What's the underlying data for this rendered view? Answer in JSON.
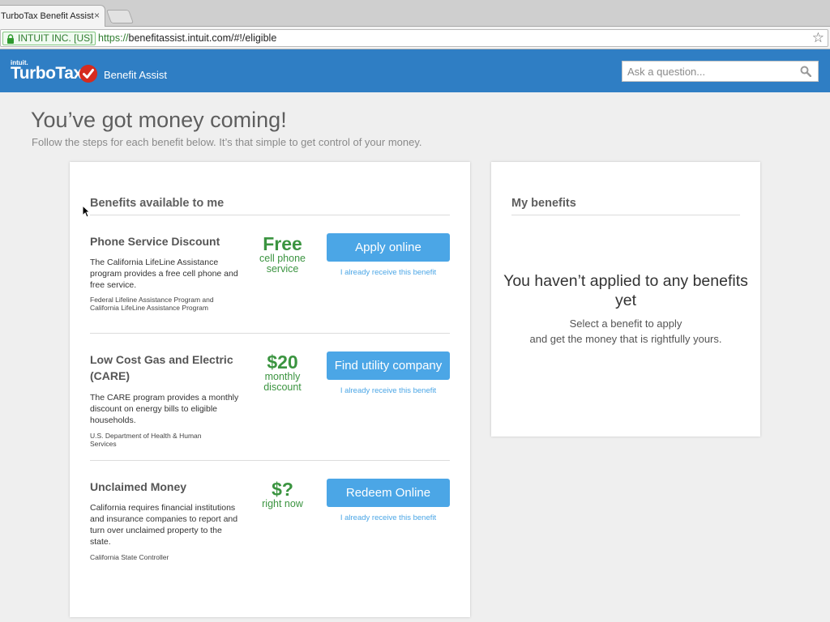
{
  "browser": {
    "tab_title": "TurboTax Benefit Assist",
    "tab_close": "×",
    "ev_label": "INTUIT INC. [US]",
    "url_scheme": "https://",
    "url_rest": "benefitassist.intuit.com/#!/eligible",
    "star": "☆"
  },
  "header": {
    "logo_intuit": "intuit.",
    "logo_product": "TurboTax",
    "app_name": "Benefit Assist",
    "search_placeholder": "Ask a question...",
    "brand_color": "#2f7ec4"
  },
  "page": {
    "title": "You’ve got money coming!",
    "subtitle": "Follow the steps for each benefit below. It’s that simple to get control of your money."
  },
  "benefits_available": {
    "heading": "Benefits available to me",
    "items": [
      {
        "title": "Phone Service Discount",
        "description": "The California LifeLine Assistance program provides a free cell phone and free service.",
        "source": "Federal Lifeline Assistance Program and California LifeLine Assistance Program",
        "amount": "Free",
        "amount_note": "cell phone service",
        "button": "Apply online",
        "link": "I already receive this benefit"
      },
      {
        "title": "Low Cost Gas and Electric (CARE)",
        "description": "The CARE program provides a monthly discount on energy bills to eligible households.",
        "source": "U.S. Department of Health & Human Services",
        "amount": "$20",
        "amount_note": "monthly discount",
        "button": "Find utility company",
        "link": "I already receive this benefit"
      },
      {
        "title": "Unclaimed Money",
        "description": "California requires financial institutions and insurance companies to report and turn over unclaimed property to the state.",
        "source": "California State Controller",
        "amount": "$?",
        "amount_note": "right now",
        "button": "Redeem Online",
        "link": "I already receive this benefit"
      }
    ]
  },
  "my_benefits": {
    "heading": "My benefits",
    "empty_title": "You haven’t applied to any benefits yet",
    "empty_line1": "Select a benefit to apply",
    "empty_line2": "and get the money that is rightfully yours."
  },
  "colors": {
    "accent_green": "#3b9440",
    "button_blue": "#4ba6e6"
  }
}
